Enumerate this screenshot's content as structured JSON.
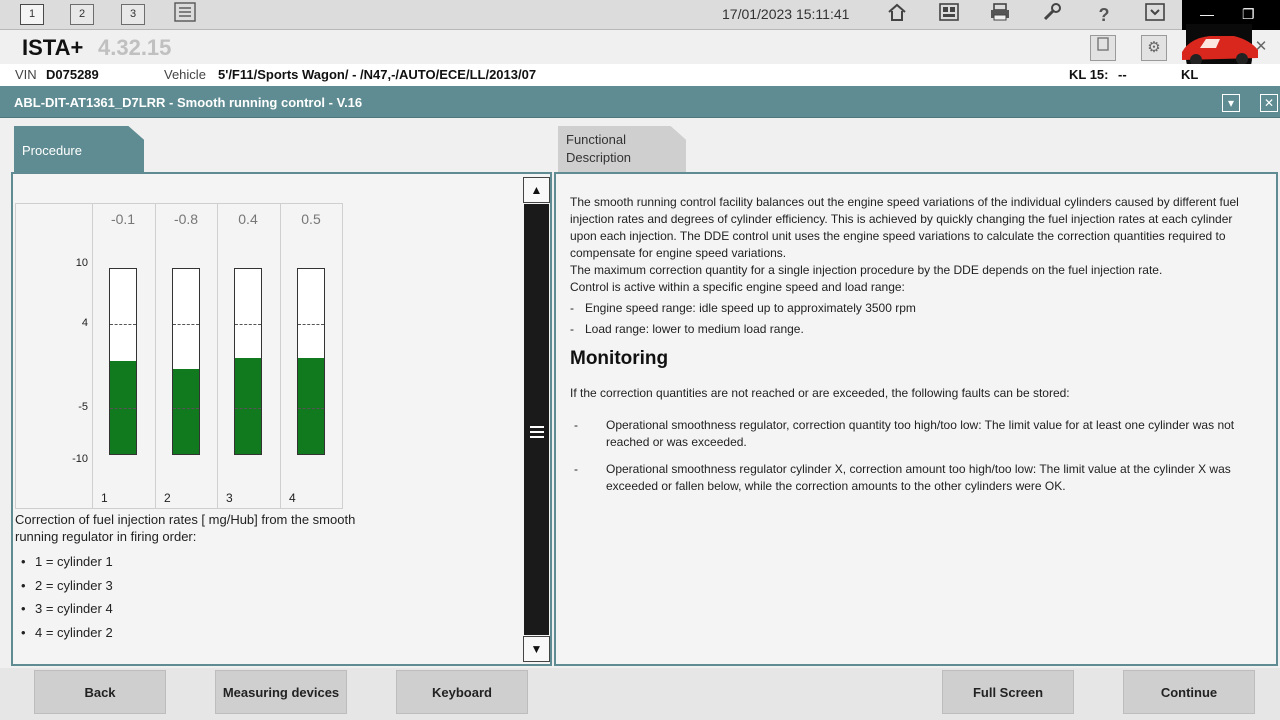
{
  "toolbar": {
    "window_tabs": [
      "1",
      "2",
      "3"
    ],
    "datetime": "17/01/2023 15:11:41",
    "icons": [
      "list-icon",
      "home-icon",
      "vehicle-info-icon",
      "print-icon",
      "wrench-icon",
      "help-icon",
      "download-icon"
    ]
  },
  "app": {
    "name": "ISTA+",
    "version": "4.32.15"
  },
  "vehicle": {
    "vin_label": "VIN",
    "vin": "D075289",
    "vehicle_label": "Vehicle",
    "vehicle": "5'/F11/Sports Wagon/ - /N47,-/AUTO/ECE/LL/2013/07",
    "kl15_label": "KL 15:",
    "kl15_value": "--",
    "kl30_label": "KL"
  },
  "procedure": {
    "title": "ABL-DIT-AT1361_D7LRR - Smooth running control - V.16"
  },
  "tabs": {
    "procedure": "Procedure",
    "functional_line1": "Functional",
    "functional_line2": "Description"
  },
  "chart_data": {
    "type": "bar",
    "categories": [
      "1",
      "2",
      "3",
      "4"
    ],
    "values": [
      -0.1,
      -0.8,
      0.4,
      0.5
    ],
    "value_labels": [
      "-0.1",
      "-0.8",
      "0.4",
      "0.5"
    ],
    "ytick_labels": [
      "10",
      "4",
      "-5",
      "-10"
    ],
    "ylim": [
      -10,
      10
    ],
    "fill_levels": [
      0.5,
      0.46,
      0.52,
      0.52
    ],
    "dashed_lines": [
      4,
      -5
    ],
    "bar_color": "#117a1e"
  },
  "chart_text": {
    "caption": "Correction of fuel injection rates [ mg/Hub] from the smooth running regulator in firing order:",
    "legend": [
      "1 = cylinder 1",
      "2 = cylinder 3",
      "3 = cylinder 4",
      "4 = cylinder 2"
    ]
  },
  "description": {
    "paragraph1": "The smooth running control facility balances out the engine speed variations of the individual cylinders caused by different fuel injection rates and degrees of cylinder efficiency. This is achieved by quickly changing the fuel injection rates at each cylinder upon each injection. The DDE control unit uses the engine speed variations to calculate the correction quantities required to compensate for engine speed variations.",
    "paragraph2": "The maximum correction quantity for a single injection procedure by the DDE depends on the fuel injection rate.",
    "paragraph3": "Control is active within a specific engine speed and load range:",
    "bullet1": "Engine speed range: idle speed up to approximately 3500 rpm",
    "bullet2": "Load range: lower to medium load range.",
    "monitoring_title": "Monitoring",
    "monitoring_intro": "If the correction quantities are not reached or are exceeded, the following faults can be stored:",
    "fault1": "Operational smoothness regulator, correction quantity too high/too low: The limit value for at least one cylinder was not reached or was exceeded.",
    "fault2": "Operational smoothness regulator cylinder X, correction amount too high/too low: The limit value at the cylinder X was exceeded or fallen below, while the correction amounts to the other cylinders were OK."
  },
  "buttons": {
    "back": "Back",
    "measuring": "Measuring devices",
    "keyboard": "Keyboard",
    "fullscreen": "Full Screen",
    "continue": "Continue"
  },
  "colors": {
    "header_teal": "#5e8c92",
    "bar_green": "#117a1e"
  }
}
